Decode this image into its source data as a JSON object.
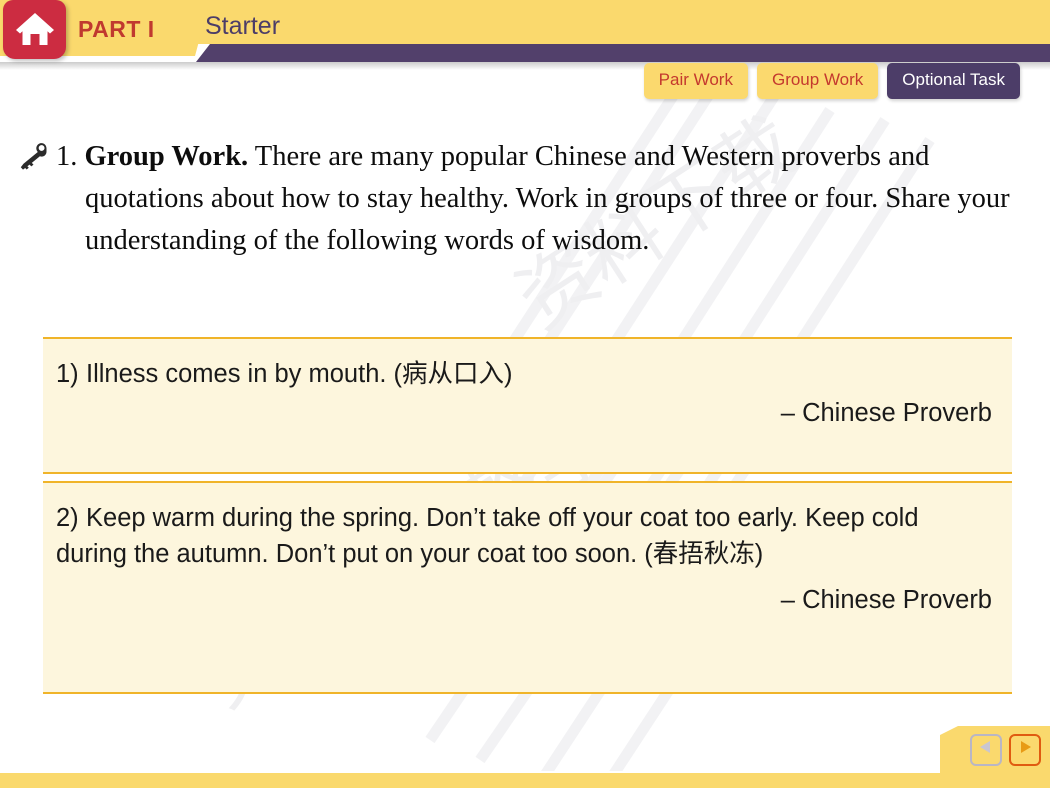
{
  "header": {
    "home_icon": "home-icon",
    "part_label": "PART I",
    "section_title": "Starter",
    "yellow_color": "#FAD96D",
    "purple_color": "#4C3D68",
    "home_color": "#CC2C41",
    "part_color": "#C0392F"
  },
  "tabs": [
    {
      "label": "Pair Work",
      "active": false
    },
    {
      "label": "Group Work",
      "active": false
    },
    {
      "label": "Optional Task",
      "active": true
    }
  ],
  "instruction": {
    "icon": "key-icon",
    "number": "1.",
    "lead": "Group Work.",
    "text": " There are many popular Chinese and Western proverbs and quotations about how to stay healthy. Work in groups of three or four. Share your understanding of the following words of wisdom."
  },
  "quotes": [
    {
      "number": "1)",
      "text": "Illness comes in by mouth. (病从口入)",
      "attribution": "– Chinese Proverb"
    },
    {
      "number": "2)",
      "text": "Keep warm during the spring. Don’t take off your coat too early. Keep cold during the autumn. Don’t put on your coat too soon. (春捂秋冻)",
      "attribution": "– Chinese Proverb"
    }
  ],
  "navigation": {
    "prev_label": "prev-slide",
    "next_label": "next-slide",
    "prev_enabled": false,
    "next_enabled": true,
    "prev_color": "#B9B6C4",
    "next_color": "#E89B16"
  },
  "colors": {
    "quote_background": "#FDF6DD",
    "quote_rule": "#F0B429"
  }
}
